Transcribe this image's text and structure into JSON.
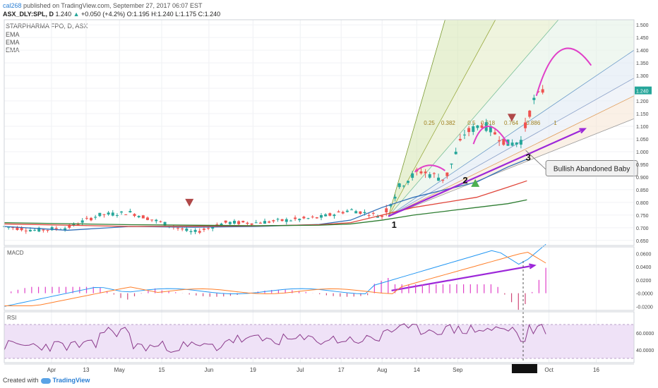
{
  "header": {
    "author": "cal268",
    "published": "published on TradingView.com, September 27, 2017 06:07 EST",
    "symbol": "ASX_DLY:SPL, D",
    "last": "1.240",
    "change": "+0.050 (+4.2%)",
    "ohlc": "O:1.195 H:1.240 L:1.175 C:1.240"
  },
  "legend": {
    "name": "STARPHARMA FPO, D, ASX",
    "ema1": "EMA",
    "ema2": "EMA",
    "ema3": "EMA"
  },
  "footer": {
    "created": "Created with",
    "brand": "TradingView"
  },
  "colors": {
    "up": "#26a69a",
    "down": "#ef5350",
    "annotation": "#9c27d9",
    "arc": "#e040c8",
    "macd": "#2196f3",
    "signal": "#ff7f2a",
    "rsi": "#8b3a8b",
    "ema_fast": "#2f6fb8",
    "ema_mid": "#e0453a",
    "ema_slow": "#2e7d32"
  },
  "chart_data": [
    {
      "type": "line",
      "name": "price",
      "x_ticks": [
        "Apr",
        "13",
        "May",
        "15",
        "Jun",
        "19",
        "Jul",
        "17",
        "Aug",
        "14",
        "Sep",
        "Oct",
        "16"
      ],
      "y_ticks": [
        "1.500",
        "1.450",
        "1.400",
        "1.350",
        "1.300",
        "1.250",
        "1.200",
        "1.150",
        "1.100",
        "1.050",
        "1.000",
        "0.950",
        "0.900",
        "0.850",
        "0.800",
        "0.750",
        "0.700",
        "0.650"
      ],
      "ylim": [
        0.63,
        1.52
      ],
      "last_price": "1.240",
      "series": [
        {
          "name": "EMA",
          "x": [
            0,
            0.1,
            0.2,
            0.3,
            0.4,
            0.5,
            0.55,
            0.6,
            0.65,
            0.7,
            0.75,
            0.8,
            0.83
          ],
          "values": [
            0.705,
            0.69,
            0.705,
            0.702,
            0.705,
            0.713,
            0.73,
            0.78,
            0.82,
            0.85,
            0.88,
            0.94,
            0.97
          ]
        },
        {
          "name": "EMA",
          "x": [
            0,
            0.2,
            0.4,
            0.5,
            0.55,
            0.6,
            0.65,
            0.7,
            0.75,
            0.8,
            0.83
          ],
          "values": [
            0.715,
            0.705,
            0.707,
            0.712,
            0.72,
            0.75,
            0.78,
            0.8,
            0.82,
            0.86,
            0.885
          ]
        },
        {
          "name": "EMA",
          "x": [
            0,
            0.2,
            0.4,
            0.5,
            0.55,
            0.6,
            0.65,
            0.7,
            0.75,
            0.8,
            0.83
          ],
          "values": [
            0.72,
            0.712,
            0.708,
            0.71,
            0.715,
            0.73,
            0.75,
            0.765,
            0.78,
            0.795,
            0.81
          ]
        }
      ],
      "fib_fan_labels": [
        "0.25",
        "0.382",
        "0.5",
        "0.618",
        "0.764",
        "0.886",
        "1"
      ],
      "annotations": [
        "1",
        "2",
        "3",
        "Bullish Abandoned Baby"
      ]
    },
    {
      "type": "line",
      "name": "MACD",
      "label": "MACD",
      "y_ticks": [
        "0.0600",
        "0.0400",
        "0.0200",
        "-0.0000",
        "-0.0200"
      ],
      "ylim": [
        -0.026,
        0.07
      ]
    },
    {
      "type": "line",
      "name": "RSI",
      "label": "RSI",
      "y_ticks": [
        "60.0000",
        "40.0000"
      ],
      "ylim": [
        25,
        85
      ]
    }
  ]
}
